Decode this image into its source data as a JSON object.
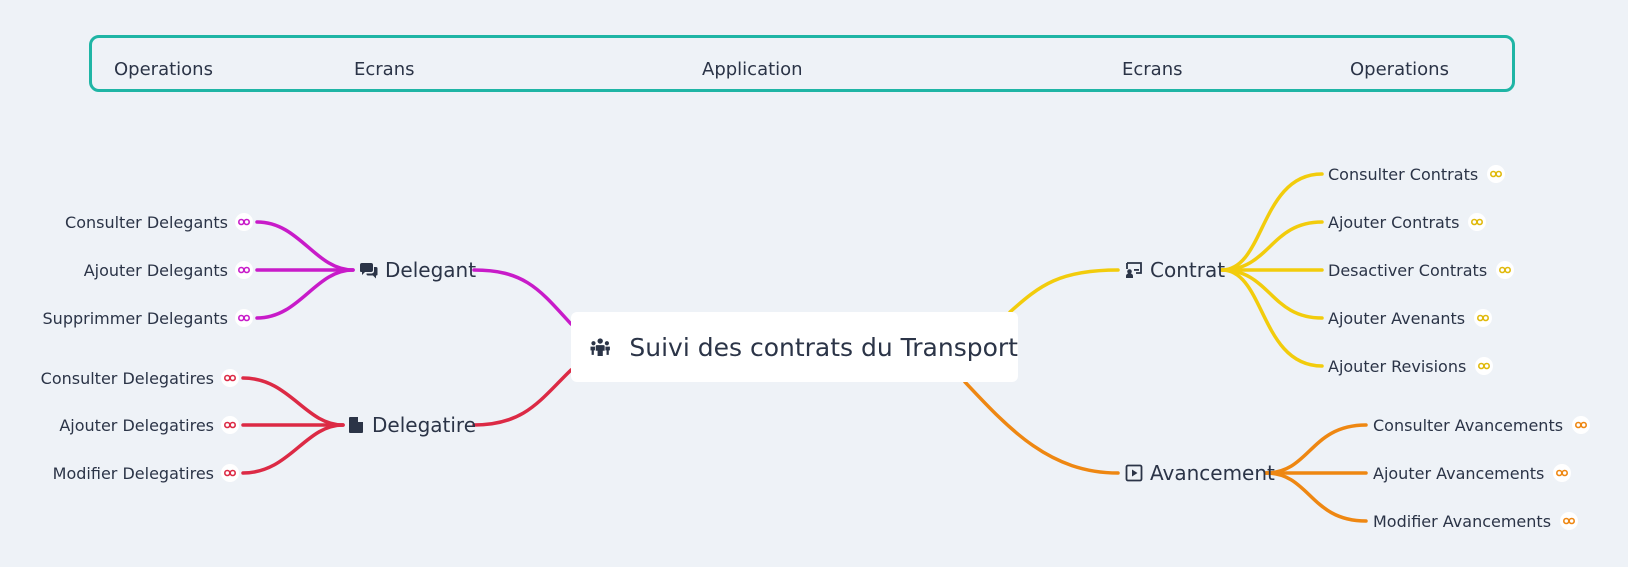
{
  "header": {
    "left_operations": "Operations",
    "left_ecrans": "Ecrans",
    "application": "Application",
    "right_ecrans": "Ecrans",
    "right_operations": "Operations"
  },
  "root": {
    "label": "Suivi des contrats du Transport",
    "icon": "people-group-icon"
  },
  "branches": {
    "delegant": {
      "label": "Delegant",
      "icon": "comments-icon",
      "color": "#c81bc9",
      "leaves": [
        "Consulter Delegants",
        "Ajouter Delegants",
        "Supprimmer Delegants"
      ]
    },
    "delegatire": {
      "label": "Delegatire",
      "icon": "file-icon",
      "color": "#dc2a45",
      "leaves": [
        "Consulter Delegatires",
        "Ajouter Delegatires",
        "Modifier Delegatires"
      ]
    },
    "contrat": {
      "label": "Contrat",
      "icon": "chalkboard-user-icon",
      "color": "#f2cc0c",
      "leaves": [
        "Consulter Contrats",
        "Ajouter Contrats",
        "Desactiver Contrats",
        "Ajouter Avenants",
        "Ajouter Revisions"
      ]
    },
    "avancement": {
      "label": "Avancement",
      "icon": "square-play-icon",
      "color": "#ee8712",
      "leaves": [
        "Consulter Avancements",
        "Ajouter Avancements",
        "Modifier Avancements"
      ]
    }
  },
  "colors": {
    "header_border": "#1fb5a5",
    "background": "#eef2f7",
    "text": "#2b3447"
  }
}
